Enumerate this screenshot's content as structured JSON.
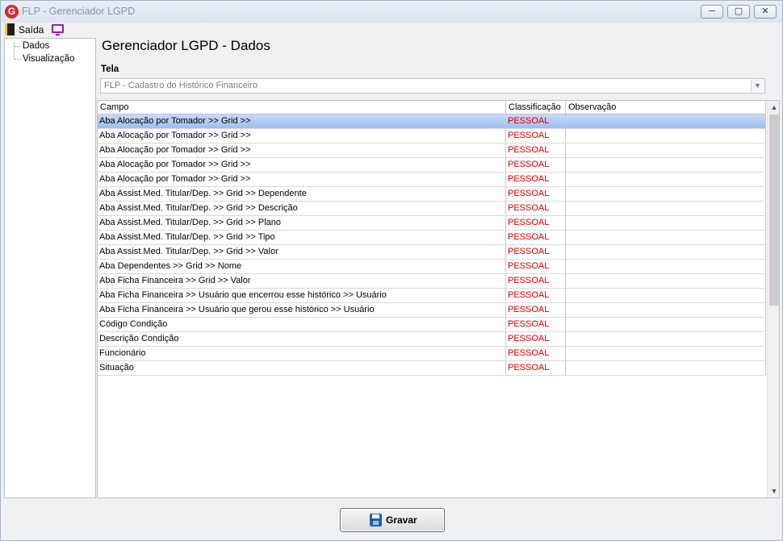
{
  "window": {
    "title": "FLP - Gerenciador LGPD",
    "logo_letter": "G"
  },
  "menu": {
    "exit_label": "Saída"
  },
  "tree": {
    "items": [
      "Dados",
      "Visualização"
    ]
  },
  "page": {
    "title": "Gerenciador LGPD - Dados",
    "tela_label": "Tela",
    "tela_value": "FLP - Cadastro do Histórico Financeiro"
  },
  "grid": {
    "columns": [
      "Campo",
      "Classificação",
      "Observação"
    ],
    "rows": [
      {
        "campo": "Aba Alocação por Tomador >> Grid >>",
        "classificacao": "PESSOAL",
        "observacao": ""
      },
      {
        "campo": "Aba Alocação por Tomador >> Grid >>",
        "classificacao": "PESSOAL",
        "observacao": ""
      },
      {
        "campo": "Aba Alocação por Tomador >> Grid >>",
        "classificacao": "PESSOAL",
        "observacao": ""
      },
      {
        "campo": "Aba Alocação por Tomador >> Grid >>",
        "classificacao": "PESSOAL",
        "observacao": ""
      },
      {
        "campo": "Aba Alocação por Tomador >> Grid >>",
        "classificacao": "PESSOAL",
        "observacao": ""
      },
      {
        "campo": "Aba Assist.Med. Titular/Dep. >> Grid >> Dependente",
        "classificacao": "PESSOAL",
        "observacao": ""
      },
      {
        "campo": "Aba Assist.Med. Titular/Dep. >> Grid >> Descrição",
        "classificacao": "PESSOAL",
        "observacao": ""
      },
      {
        "campo": "Aba Assist.Med. Titular/Dep. >> Grid >> Plano",
        "classificacao": "PESSOAL",
        "observacao": ""
      },
      {
        "campo": "Aba Assist.Med. Titular/Dep. >> Grid >> Tipo",
        "classificacao": "PESSOAL",
        "observacao": ""
      },
      {
        "campo": "Aba Assist.Med. Titular/Dep. >> Grid >> Valor",
        "classificacao": "PESSOAL",
        "observacao": ""
      },
      {
        "campo": "Aba Dependentes >> Grid >> Nome",
        "classificacao": "PESSOAL",
        "observacao": ""
      },
      {
        "campo": "Aba Ficha Financeira >> Grid >> Valor",
        "classificacao": "PESSOAL",
        "observacao": ""
      },
      {
        "campo": "Aba Ficha Financeira >> Usuário que encerrou esse histórico >> Usuário",
        "classificacao": "PESSOAL",
        "observacao": ""
      },
      {
        "campo": "Aba Ficha Financeira >> Usuário que gerou esse histórico >> Usuário",
        "classificacao": "PESSOAL",
        "observacao": ""
      },
      {
        "campo": "Código Condição",
        "classificacao": "PESSOAL",
        "observacao": ""
      },
      {
        "campo": "Descrição Condição",
        "classificacao": "PESSOAL",
        "observacao": ""
      },
      {
        "campo": "Funcionário",
        "classificacao": "PESSOAL",
        "observacao": ""
      },
      {
        "campo": "Situação",
        "classificacao": "PESSOAL",
        "observacao": ""
      }
    ],
    "selected_row": 0
  },
  "footer": {
    "save_label": "Gravar"
  },
  "colors": {
    "classification_text": "#d40000",
    "selection": "#9ebdf0"
  },
  "icons": [
    "app-logo-icon",
    "exit-door-icon",
    "monitor-icon",
    "floppy-disk-icon",
    "chevron-down-icon",
    "chevron-up-icon"
  ]
}
